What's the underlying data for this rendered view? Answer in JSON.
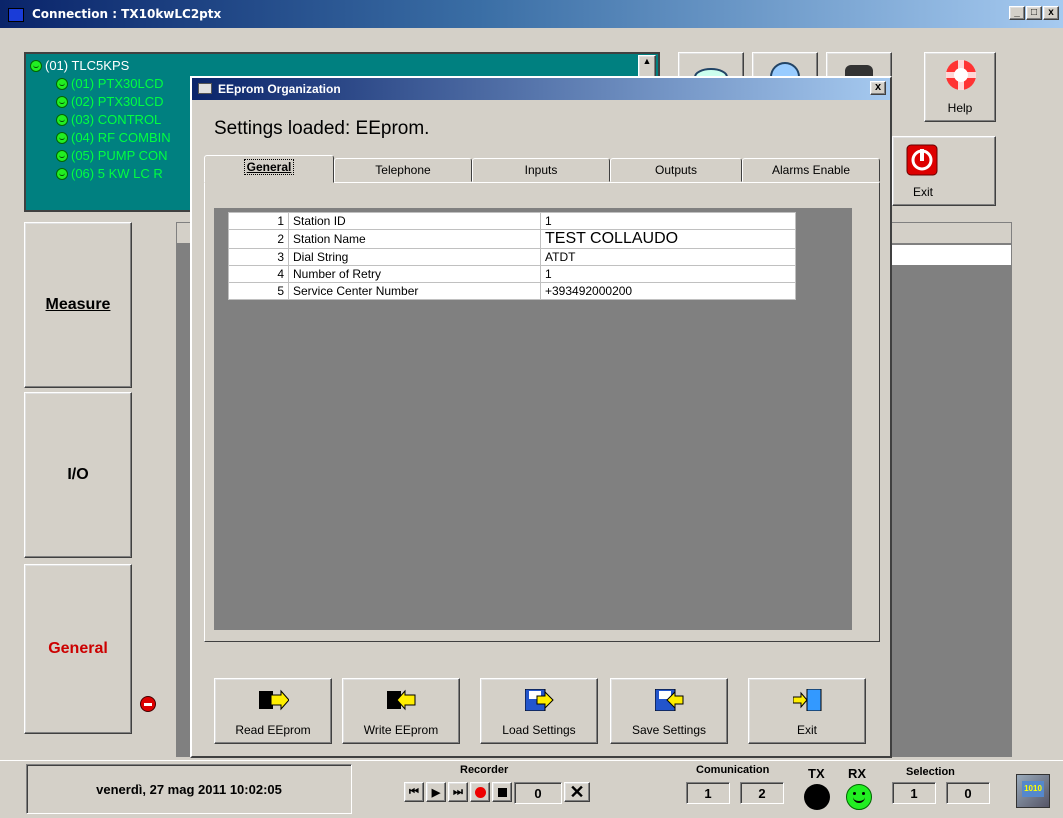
{
  "window": {
    "title": "Connection : TX10kwLC2ptx"
  },
  "tree": {
    "root": "(01) TLC5KPS",
    "items": [
      "(01) PTX30LCD",
      "(02) PTX30LCD",
      "(03) CONTROL",
      "(04) RF COMBIN",
      "(05) PUMP CON",
      "(06) 5 KW LC R"
    ]
  },
  "toolbar": {
    "help_label": "Help",
    "exit_label": "Exit"
  },
  "nav": {
    "measure": "Measure",
    "io": "I/O",
    "general": "General"
  },
  "dialog": {
    "title": "EEprom Organization",
    "settings_loaded": "Settings loaded:  EEprom.",
    "tabs": [
      "General",
      "Telephone",
      "Inputs",
      "Outputs",
      "Alarms Enable"
    ],
    "rows": [
      {
        "n": "1",
        "param": "Station ID",
        "value": "1"
      },
      {
        "n": "2",
        "param": "Station Name",
        "value": "TEST COLLAUDO"
      },
      {
        "n": "3",
        "param": "Dial String",
        "value": "ATDT"
      },
      {
        "n": "4",
        "param": "Number of Retry",
        "value": "1"
      },
      {
        "n": "5",
        "param": "Service Center Number",
        "value": "+393492000200"
      }
    ],
    "buttons": {
      "read": "Read EEprom",
      "write": "Write EEprom",
      "load": "Load Settings",
      "save": "Save Settings",
      "exit": "Exit"
    }
  },
  "status": {
    "datetime": "venerdì, 27 mag 2011  10:02:05",
    "recorder_label": "Recorder",
    "recorder_count": "0",
    "comunication_label": "Comunication",
    "com_value_1": "1",
    "com_value_2": "2",
    "tx_label": "TX",
    "rx_label": "RX",
    "selection_label": "Selection",
    "sel_value_1": "1",
    "sel_value_2": "0"
  },
  "colors": {
    "tree_bg": "#008080",
    "tree_text": "#00ff40",
    "general_nav": "#cc0000"
  }
}
